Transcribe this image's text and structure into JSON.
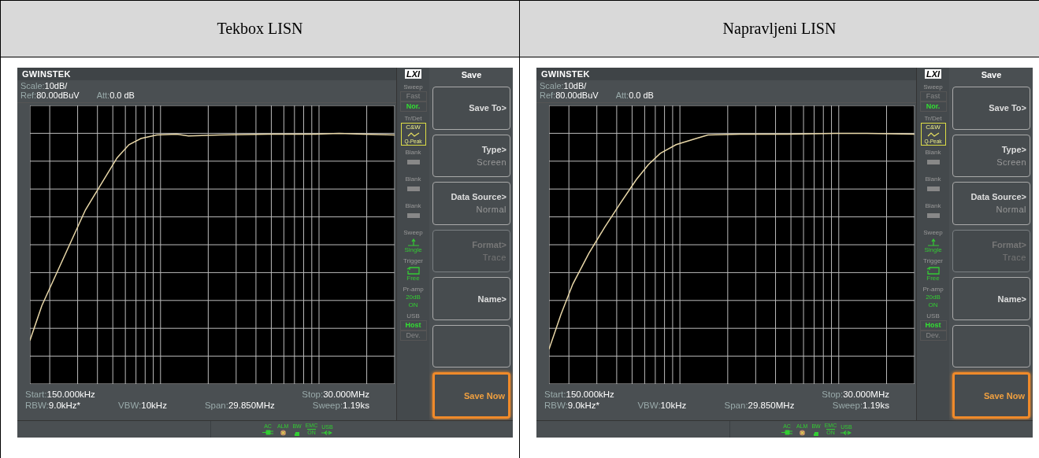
{
  "columns": [
    {
      "heading": "Tekbox LISN",
      "screen": {
        "brand": "GWINSTEK",
        "lxi": "LXI",
        "scale_label": "Scale:",
        "scale": "10dB/",
        "ref_label": "Ref:",
        "ref": "80.00dBuV",
        "att_label": "Att:",
        "att": "0.0 dB",
        "start_label": "Start:",
        "start": "150.000kHz",
        "stop_label": "Stop:",
        "stop": "30.000MHz",
        "rbw_label": "RBW:",
        "rbw": "9.0kHz*",
        "vbw_label": "VBW:",
        "vbw": "10kHz",
        "span_label": "Span:",
        "span": "29.850MHz",
        "sweep_label": "Sweep:",
        "sweep": "1.19ks",
        "side": [
          {
            "kind": "toggle",
            "title": "Sweep",
            "options": [
              {
                "label": "Fast",
                "selected": false
              },
              {
                "label": "Nor.",
                "selected": true
              }
            ]
          },
          {
            "kind": "trace",
            "title": "Tr/Det",
            "top": "C&W",
            "bottom": "Q-Peak"
          },
          {
            "kind": "blank",
            "title": "Blank"
          },
          {
            "kind": "blank",
            "title": "Blank"
          },
          {
            "kind": "blank",
            "title": "Blank"
          },
          {
            "kind": "single",
            "title": "Sweep",
            "label": "Single"
          },
          {
            "kind": "loop",
            "title": "Trigger",
            "label": "Free"
          },
          {
            "kind": "text",
            "title": "Pr-amp",
            "lines": [
              "20dB",
              "ON"
            ]
          },
          {
            "kind": "toggle",
            "title": "USB",
            "options": [
              {
                "label": "Host",
                "selected": true
              },
              {
                "label": "Dev.",
                "selected": false
              }
            ]
          }
        ],
        "menu_title": "Save",
        "menu": [
          {
            "label": "Save To>",
            "disabled": false,
            "highlighted": false
          },
          {
            "label": "Type>",
            "value": "Screen",
            "disabled": false,
            "highlighted": false
          },
          {
            "label": "Data Source>",
            "value": "Normal",
            "disabled": false,
            "highlighted": false
          },
          {
            "label": "Format>",
            "value": "Trace",
            "disabled": true,
            "highlighted": false
          },
          {
            "label": "Name>",
            "disabled": false,
            "highlighted": false
          },
          {
            "disabled": false,
            "highlighted": false
          },
          {
            "label": "Save Now",
            "disabled": false,
            "highlighted": true
          }
        ],
        "status": [
          {
            "kind": "plug",
            "label": "AC"
          },
          {
            "kind": "alarm",
            "label": "ALM"
          },
          {
            "kind": "hand",
            "label": "BW"
          },
          {
            "kind": "emc",
            "label": "EMC",
            "value": "ON"
          },
          {
            "kind": "usb",
            "label": "USB"
          }
        ]
      }
    },
    {
      "heading": "Napravljeni LISN",
      "screen": {
        "brand": "GWINSTEK",
        "lxi": "LXI",
        "scale_label": "Scale:",
        "scale": "10dB/",
        "ref_label": "Ref:",
        "ref": "80.00dBuV",
        "att_label": "Att:",
        "att": "0.0 dB",
        "start_label": "Start:",
        "start": "150.000kHz",
        "stop_label": "Stop:",
        "stop": "30.000MHz",
        "rbw_label": "RBW:",
        "rbw": "9.0kHz*",
        "vbw_label": "VBW:",
        "vbw": "10kHz",
        "span_label": "Span:",
        "span": "29.850MHz",
        "sweep_label": "Sweep:",
        "sweep": "1.19ks",
        "side": [
          {
            "kind": "toggle",
            "title": "Sweep",
            "options": [
              {
                "label": "Fast",
                "selected": false
              },
              {
                "label": "Nor.",
                "selected": true
              }
            ]
          },
          {
            "kind": "trace",
            "title": "Tr/Det",
            "top": "C&W",
            "bottom": "Q-Peak"
          },
          {
            "kind": "blank",
            "title": "Blank"
          },
          {
            "kind": "blank",
            "title": "Blank"
          },
          {
            "kind": "blank",
            "title": "Blank"
          },
          {
            "kind": "single",
            "title": "Sweep",
            "label": "Single"
          },
          {
            "kind": "loop",
            "title": "Trigger",
            "label": "Free"
          },
          {
            "kind": "text",
            "title": "Pr-amp",
            "lines": [
              "20dB",
              "ON"
            ]
          },
          {
            "kind": "toggle",
            "title": "USB",
            "options": [
              {
                "label": "Host",
                "selected": true
              },
              {
                "label": "Dev.",
                "selected": false
              }
            ]
          }
        ],
        "menu_title": "Save",
        "menu": [
          {
            "label": "Save To>",
            "disabled": false,
            "highlighted": false
          },
          {
            "label": "Type>",
            "value": "Screen",
            "disabled": false,
            "highlighted": false
          },
          {
            "label": "Data Source>",
            "value": "Normal",
            "disabled": false,
            "highlighted": false
          },
          {
            "label": "Format>",
            "value": "Trace",
            "disabled": true,
            "highlighted": false
          },
          {
            "label": "Name>",
            "disabled": false,
            "highlighted": false
          },
          {
            "disabled": false,
            "highlighted": false
          },
          {
            "label": "Save Now",
            "disabled": false,
            "highlighted": true
          }
        ],
        "status": [
          {
            "kind": "plug",
            "label": "AC"
          },
          {
            "kind": "alarm",
            "label": "ALM"
          },
          {
            "kind": "hand",
            "label": "BW"
          },
          {
            "kind": "emc",
            "label": "EMC",
            "value": "ON"
          },
          {
            "kind": "usb",
            "label": "USB"
          }
        ]
      }
    }
  ]
}
